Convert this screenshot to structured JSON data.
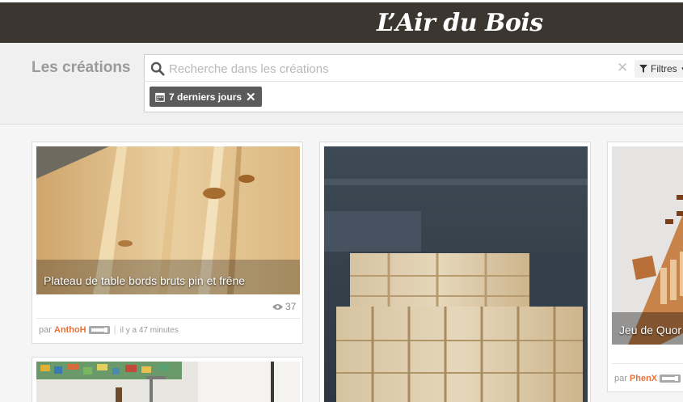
{
  "header": {
    "brand": "L’Air du Bois"
  },
  "toolbar": {
    "section_title": "Les créations",
    "search_placeholder": "Recherche dans les créations",
    "clear_label": "✕",
    "filters_label": "Filtres",
    "active_tag": "7 derniers jours",
    "tag_remove": "✕"
  },
  "cards": [
    {
      "title": "Plateau de table bords bruts pin et frêne",
      "views": "37",
      "by_prefix": "par",
      "author": "AnthoH",
      "time": "il y a 47 minutes"
    },
    {
      "title": "",
      "views": "",
      "by_prefix": "",
      "author": "",
      "time": ""
    },
    {
      "title": "Jeu de Quor",
      "by_prefix": "par",
      "author": "PhenX"
    }
  ],
  "colors": {
    "topbar": "#3c3630",
    "accent": "#e8733a",
    "tag": "#5b5b5b"
  }
}
